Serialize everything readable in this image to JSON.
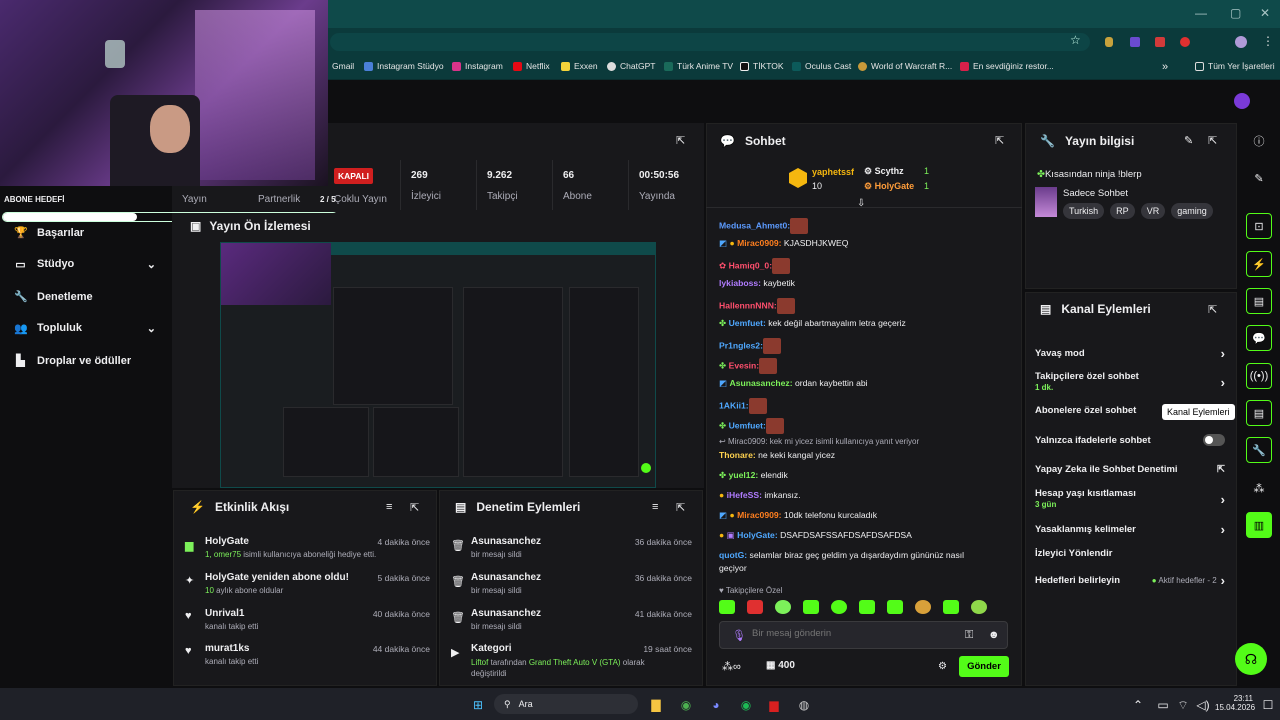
{
  "browser": {
    "bookmarks": [
      "Gmail",
      "Instagram Stüdyo",
      "Instagram",
      "Netflix",
      "Exxen",
      "ChatGPT",
      "Türk Anime TV",
      "TİKTOK",
      "Oculus Cast",
      "World of Warcraft R...",
      "En sevdiğiniz restor..."
    ],
    "all_bookmarks": "Tüm Yer İşaretleri"
  },
  "overlay": {
    "goal_label": "ABONE HEDEFİ",
    "goal_count": "2 / 5"
  },
  "sidebar": {
    "items": [
      {
        "label": "Başarılar",
        "icon": "trophy-icon"
      },
      {
        "label": "Stüdyo",
        "icon": "studio-icon"
      },
      {
        "label": "Denetleme",
        "icon": "wrench-icon"
      },
      {
        "label": "Topluluk",
        "icon": "community-icon"
      },
      {
        "label": "Droplar ve ödüller",
        "icon": "drops-icon"
      }
    ],
    "yayin": "Yayın",
    "partnerlik": "Partnerlik",
    "coklu": "Çoklu Yayın"
  },
  "stats": {
    "status": "KAPALI",
    "items": [
      {
        "value": "269",
        "label": "İzleyici"
      },
      {
        "value": "9.262",
        "label": "Takipçi"
      },
      {
        "value": "66",
        "label": "Abone"
      },
      {
        "value": "00:50:56",
        "label": "Yayında"
      }
    ]
  },
  "preview": {
    "title": "Yayın Ön İzlemesi"
  },
  "events": {
    "title": "Etkinlik Akışı",
    "items": [
      {
        "name": "HolyGate",
        "sub_a": "1, omer75",
        "sub_b": " isimli kullanıcıya aboneliği hediye etti.",
        "time": "4 dakika önce"
      },
      {
        "name": "HolyGate yeniden abone oldu!",
        "sub_a": "10",
        "sub_b": " aylık abone oldular",
        "time": "5 dakika önce"
      },
      {
        "name": "Unrival1",
        "sub_a": "",
        "sub_b": "kanalı takip etti",
        "time": "40 dakika önce"
      },
      {
        "name": "murat1ks",
        "sub_a": "",
        "sub_b": "kanalı takip etti",
        "time": "44 dakika önce"
      }
    ]
  },
  "mod": {
    "title": "Denetim Eylemleri",
    "items": [
      {
        "name": "Asunasanchez",
        "sub": "bir mesajı sildi",
        "time": "36 dakika önce"
      },
      {
        "name": "Asunasanchez",
        "sub": "bir mesajı sildi",
        "time": "36 dakika önce"
      },
      {
        "name": "Asunasanchez",
        "sub": "bir mesajı sildi",
        "time": "41 dakika önce"
      },
      {
        "name": "Kategori",
        "sub_a": "Liftof",
        "sub_b": " tarafından ",
        "sub_c": "Grand Theft Auto V (GTA)",
        "sub_d": " olarak değiştirildi",
        "time": "19 saat önce"
      }
    ]
  },
  "chat": {
    "title": "Sohbet",
    "leader1": {
      "name": "yaphetssf",
      "count": "10"
    },
    "leader2": {
      "name": "Scythz",
      "count": "1"
    },
    "leader3": {
      "name": "HolyGate",
      "count": "1"
    },
    "messages": [
      {
        "user": "Medusa_Ahmet0:",
        "color": "#5c9bff",
        "text": ""
      },
      {
        "user": "Mirac0909:",
        "color": "#ff7f1f",
        "text": " KJASDHJKWEQ"
      },
      {
        "user": "Hamiq0_0:",
        "color": "#ff4f6d",
        "text": ""
      },
      {
        "user": "lykiaboss:",
        "color": "#b07cff",
        "text": " kaybetik"
      },
      {
        "user": "HallennnNNN:",
        "color": "#ff4f6d",
        "text": ""
      },
      {
        "user": "Uemfuet:",
        "color": "#4fa8ff",
        "text": " kek değil abartmayalım letra geçeriz"
      },
      {
        "user": "Pr1ngles2:",
        "color": "#4fa8ff",
        "text": ""
      },
      {
        "user": "Evesin:",
        "color": "#ff4f6d",
        "text": ""
      },
      {
        "user": "Asunasanchez:",
        "color": "#7cf05a",
        "text": " ordan kaybettin abi"
      },
      {
        "user": "1AKii1:",
        "color": "#4fa8ff",
        "text": ""
      },
      {
        "user": "Uemfuet:",
        "color": "#4fa8ff",
        "text": ""
      },
      {
        "user": "Thonare:",
        "color": "#ffd24f",
        "text": " ne keki kangal yicez",
        "reply": "Mirac0909: kek mi yicez isimli kullanıcıya yanıt veriyor"
      },
      {
        "user": "yuel12:",
        "color": "#7cf05a",
        "text": " elendik"
      },
      {
        "user": "iHefeSS:",
        "color": "#b07cff",
        "text": " imkansız."
      },
      {
        "user": "Mirac0909:",
        "color": "#ff7f1f",
        "text": " 10dk telefonu kurcaladık"
      },
      {
        "user": "HolyGate:",
        "color": "#4fa8ff",
        "text": " DSAFDSAFSSAFDSAFDSAFDSA"
      },
      {
        "user": "quotG:",
        "color": "#4fa8ff",
        "text": " selamlar biraz geç geldim ya dışardaydım gününüz nasıl"
      },
      {
        "user": "",
        "color": "#efeff1",
        "text": "geçiyor"
      }
    ],
    "followers_only": "Takipçilere Özel",
    "placeholder": "Bir mesaj gönderin",
    "points": "400",
    "send": "Gönder"
  },
  "streaminfo": {
    "title": "Yayın bilgisi",
    "stream_title": "Kısasından ninja !blerp",
    "category": "Sadece Sohbet",
    "tags": [
      "Turkish",
      "RP",
      "VR",
      "gaming"
    ]
  },
  "channel": {
    "title": "Kanal Eylemleri",
    "tooltip": "Kanal Eylemleri",
    "items": [
      {
        "label": "Yavaş mod",
        "sub": ""
      },
      {
        "label": "Takipçilere özel sohbet",
        "sub": "1 dk."
      },
      {
        "label": "Abonelere özel sohbet",
        "sub": ""
      },
      {
        "label": "Yalnızca ifadelerle sohbet",
        "sub": ""
      },
      {
        "label": "Yapay Zeka ile Sohbet Denetimi",
        "sub": ""
      },
      {
        "label": "Hesap yaşı kısıtlaması",
        "sub": "3 gün"
      },
      {
        "label": "Yasaklanmış kelimeler",
        "sub": ""
      },
      {
        "label": "İzleyici Yönlendir",
        "sub": ""
      },
      {
        "label": "Hedefleri belirleyin",
        "sub": "Aktif hedefler - 2"
      }
    ]
  },
  "taskbar": {
    "search": "Ara",
    "time": "23:11",
    "date": "15.04.2026"
  },
  "colors": {
    "accent": "#53fc18",
    "bg": "#0e0e10",
    "panel": "#18181b"
  }
}
